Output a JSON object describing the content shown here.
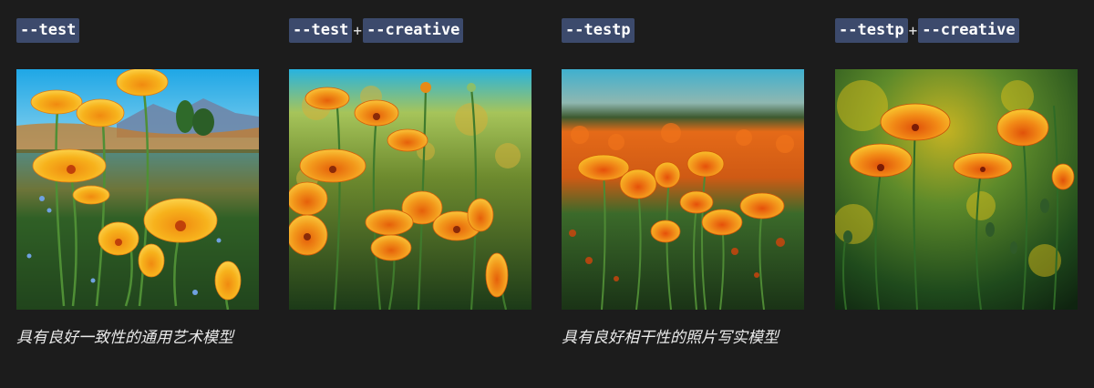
{
  "columns": [
    {
      "tags": [
        "--test"
      ],
      "image": {
        "name": "poppy-meadow-mountains-image",
        "style": "painterly-meadow"
      },
      "caption": "具有良好一致性的通用艺术模型"
    },
    {
      "tags": [
        "--test",
        "--creative"
      ],
      "separator": "+",
      "image": {
        "name": "poppy-field-creative-image",
        "style": "dense-painterly"
      },
      "caption": ""
    },
    {
      "tags": [
        "--testp"
      ],
      "image": {
        "name": "poppy-field-photo-image",
        "style": "photographic-bokeh"
      },
      "caption": "具有良好相干性的照片写实模型"
    },
    {
      "tags": [
        "--testp",
        "--creative"
      ],
      "separator": "+",
      "image": {
        "name": "poppy-closeup-creative-photo-image",
        "style": "dark-closeup"
      },
      "caption": ""
    }
  ],
  "colors": {
    "background": "#1c1c1c",
    "tag_background": "#3c4a6c",
    "tag_text": "#ffffff",
    "caption_text": "#e9e9e9",
    "poppy_orange": "#f39a1c",
    "poppy_yellow": "#f7c21e",
    "stem_green": "#3f7a2c"
  }
}
